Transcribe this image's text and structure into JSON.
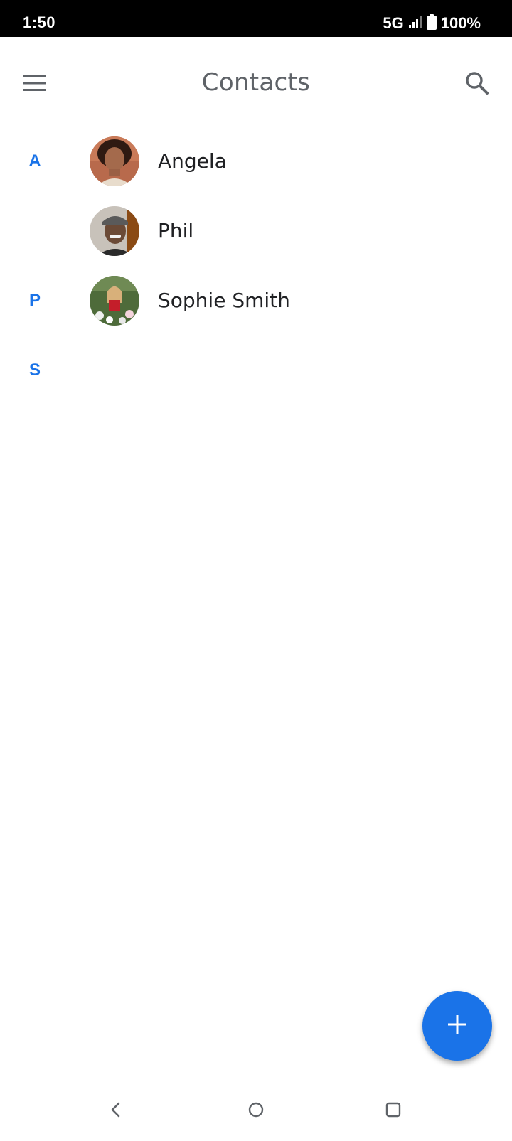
{
  "status_bar": {
    "time": "1:50",
    "network": "5G",
    "battery": "100%"
  },
  "app_bar": {
    "title": "Contacts",
    "menu_icon": "menu-icon",
    "search_icon": "search-icon"
  },
  "sections": [
    {
      "letter": "A"
    },
    {
      "letter": "P"
    },
    {
      "letter": "S"
    }
  ],
  "contacts": [
    {
      "name": "Angela",
      "avatar": "photo"
    },
    {
      "name": "Phil",
      "avatar": "photo"
    },
    {
      "name": "Sophie Smith",
      "avatar": "photo"
    }
  ],
  "fab": {
    "icon": "add-icon"
  },
  "colors": {
    "accent": "#1a73e8",
    "title": "#5f6368",
    "text": "#202124",
    "status_bar": "#000000"
  }
}
